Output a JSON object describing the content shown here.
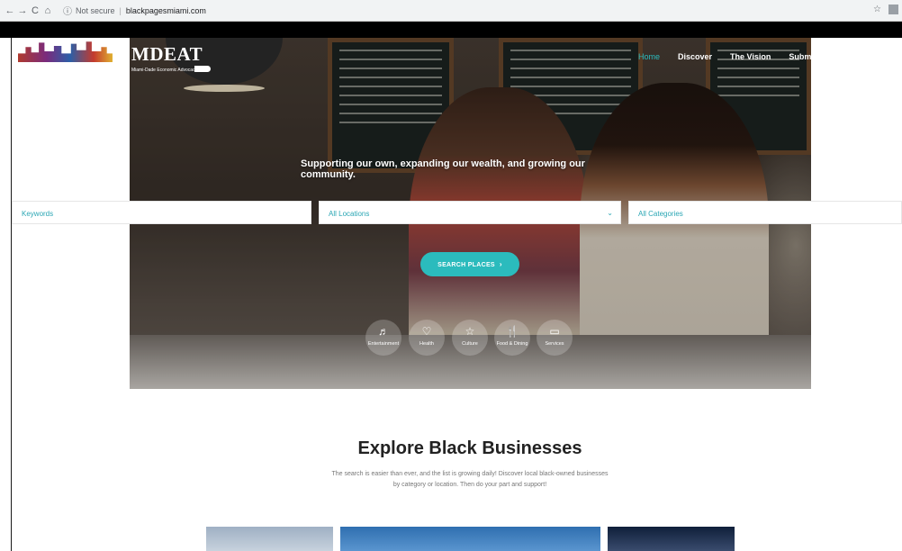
{
  "browser": {
    "back": "←",
    "forward": "→",
    "reload": "C",
    "home": "⌂",
    "info": "ⓘ",
    "not_secure": "Not secure",
    "separator": "|",
    "url": "blackpagesmiami.com",
    "bookmark": "☆"
  },
  "logo": {
    "title": "MDEAT",
    "subtitle": "Miami-Dade Economic Advocacy Trust"
  },
  "nav": [
    "Home",
    "Discover",
    "The Vision",
    "Submit A"
  ],
  "hero": {
    "tagline": "Supporting our own, expanding our wealth, and growing our community."
  },
  "search": {
    "keywords_placeholder": "Keywords",
    "locations_placeholder": "All Locations",
    "categories_placeholder": "All Categories",
    "chevron": "⌄",
    "button_label": "SEARCH PLACES",
    "button_arrow": "›"
  },
  "categories": [
    {
      "label": "Entertainment",
      "icon": "music-note-icon",
      "glyph": "♬"
    },
    {
      "label": "Health",
      "icon": "heart-rate-icon",
      "glyph": "♡"
    },
    {
      "label": "Culture",
      "icon": "star-icon",
      "glyph": "☆"
    },
    {
      "label": "Food & Dining",
      "icon": "fork-knife-icon",
      "glyph": "🍴"
    },
    {
      "label": "Services",
      "icon": "briefcase-icon",
      "glyph": "▭"
    }
  ],
  "explore": {
    "title": "Explore Black Businesses",
    "description": "The search is easier than ever, and the list is growing daily! Discover local black-owned businesses by category or location. Then do your part and support!"
  },
  "colors": {
    "accent": "#2bbbbd",
    "nav_active": "#2bbbbd",
    "field_text": "#2aa6b4"
  }
}
